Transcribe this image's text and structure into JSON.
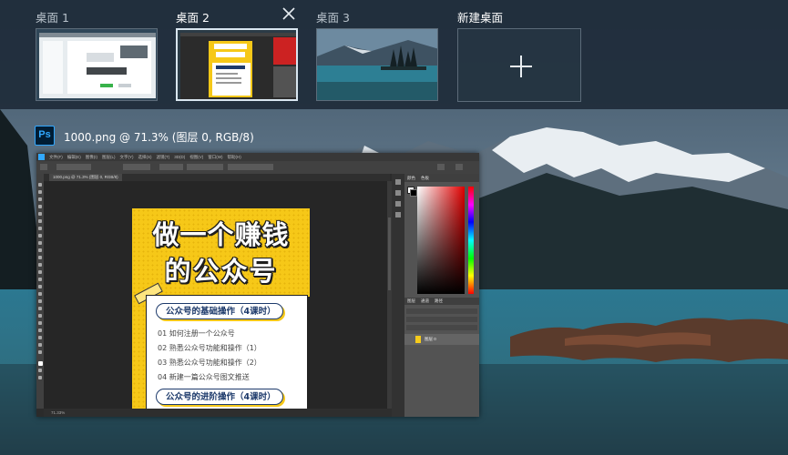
{
  "desktops": [
    {
      "label": "桌面 1",
      "active": false
    },
    {
      "label": "桌面 2",
      "active": true
    },
    {
      "label": "桌面 3",
      "active": false
    }
  ],
  "new_desktop": {
    "label": "新建桌面"
  },
  "icons": {
    "close": "close-icon",
    "plus": "plus-icon",
    "app": "photoshop-icon"
  },
  "window": {
    "app_glyph": "Ps",
    "title": "1000.png @ 71.3% (图层 0, RGB/8)"
  },
  "photoshop": {
    "menus": [
      "文件(F)",
      "编辑(E)",
      "图像(I)",
      "图层(L)",
      "文字(Y)",
      "选择(S)",
      "滤镜(T)",
      "3D(D)",
      "视图(V)",
      "窗口(W)",
      "帮助(H)"
    ],
    "doc_tab": "1000.png @ 71.3% (图层 0, RGB/8)",
    "zoom": "71.33%",
    "panels": {
      "color_tabs": [
        "颜色",
        "色板"
      ],
      "layer_tabs": [
        "图层",
        "通道",
        "路径"
      ],
      "layer_name": "图层 0"
    }
  },
  "poster": {
    "title_line1": "做一个赚钱",
    "title_line2": "的公众号",
    "section1": "公众号的基础操作（4课时）",
    "lessons": [
      "01 如何注册一个公众号",
      "02 熟悉公众号功能和操作（1）",
      "03 熟悉公众号功能和操作（2）",
      "04 新建一篇公众号图文推送"
    ],
    "section2": "公众号的进阶操作（4课时）"
  },
  "colors": {
    "strip_bg": "#1f2c3a",
    "active_border": "#d9e6f0",
    "ps_accent": "#31a8ff",
    "poster_yellow": "#f6c818",
    "pill_text": "#1d3a6b"
  }
}
